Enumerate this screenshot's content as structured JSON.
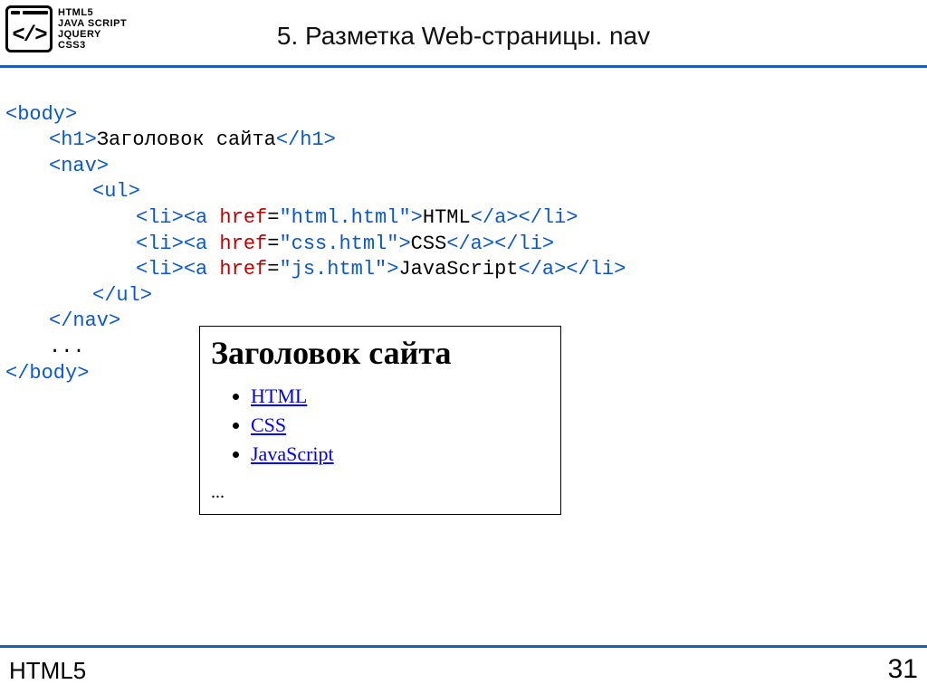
{
  "header": {
    "logo_lines": [
      "HTML5",
      "JAVA SCRIPT",
      "JQUERY",
      "CSS3"
    ],
    "logo_symbol": "</>",
    "title": "5. Разметка Web-страницы. nav"
  },
  "code": {
    "body_open": "<body>",
    "h1_open": "<h1>",
    "h1_text": "Заголовок сайта",
    "h1_close": "</h1>",
    "nav_open": "<nav>",
    "ul_open": "<ul>",
    "li_open": "<li>",
    "a_open": "<a",
    "href_attr": "href",
    "href1": "\"html.html\"",
    "link1_text": "HTML",
    "href2": "\"css.html\"",
    "link2_text": "CSS",
    "href3": "\"js.html\"",
    "link3_text": "JavaScript",
    "a_close": "</a>",
    "li_close": "</li>",
    "ul_close": "</ul>",
    "nav_close": "</nav>",
    "ellipsis": "...",
    "body_close": "</body>"
  },
  "preview": {
    "heading": "Заголовок сайта",
    "links": [
      "HTML",
      "CSS",
      "JavaScript"
    ],
    "ellipsis": "..."
  },
  "footer": {
    "left": "HTML5",
    "right": "31"
  }
}
